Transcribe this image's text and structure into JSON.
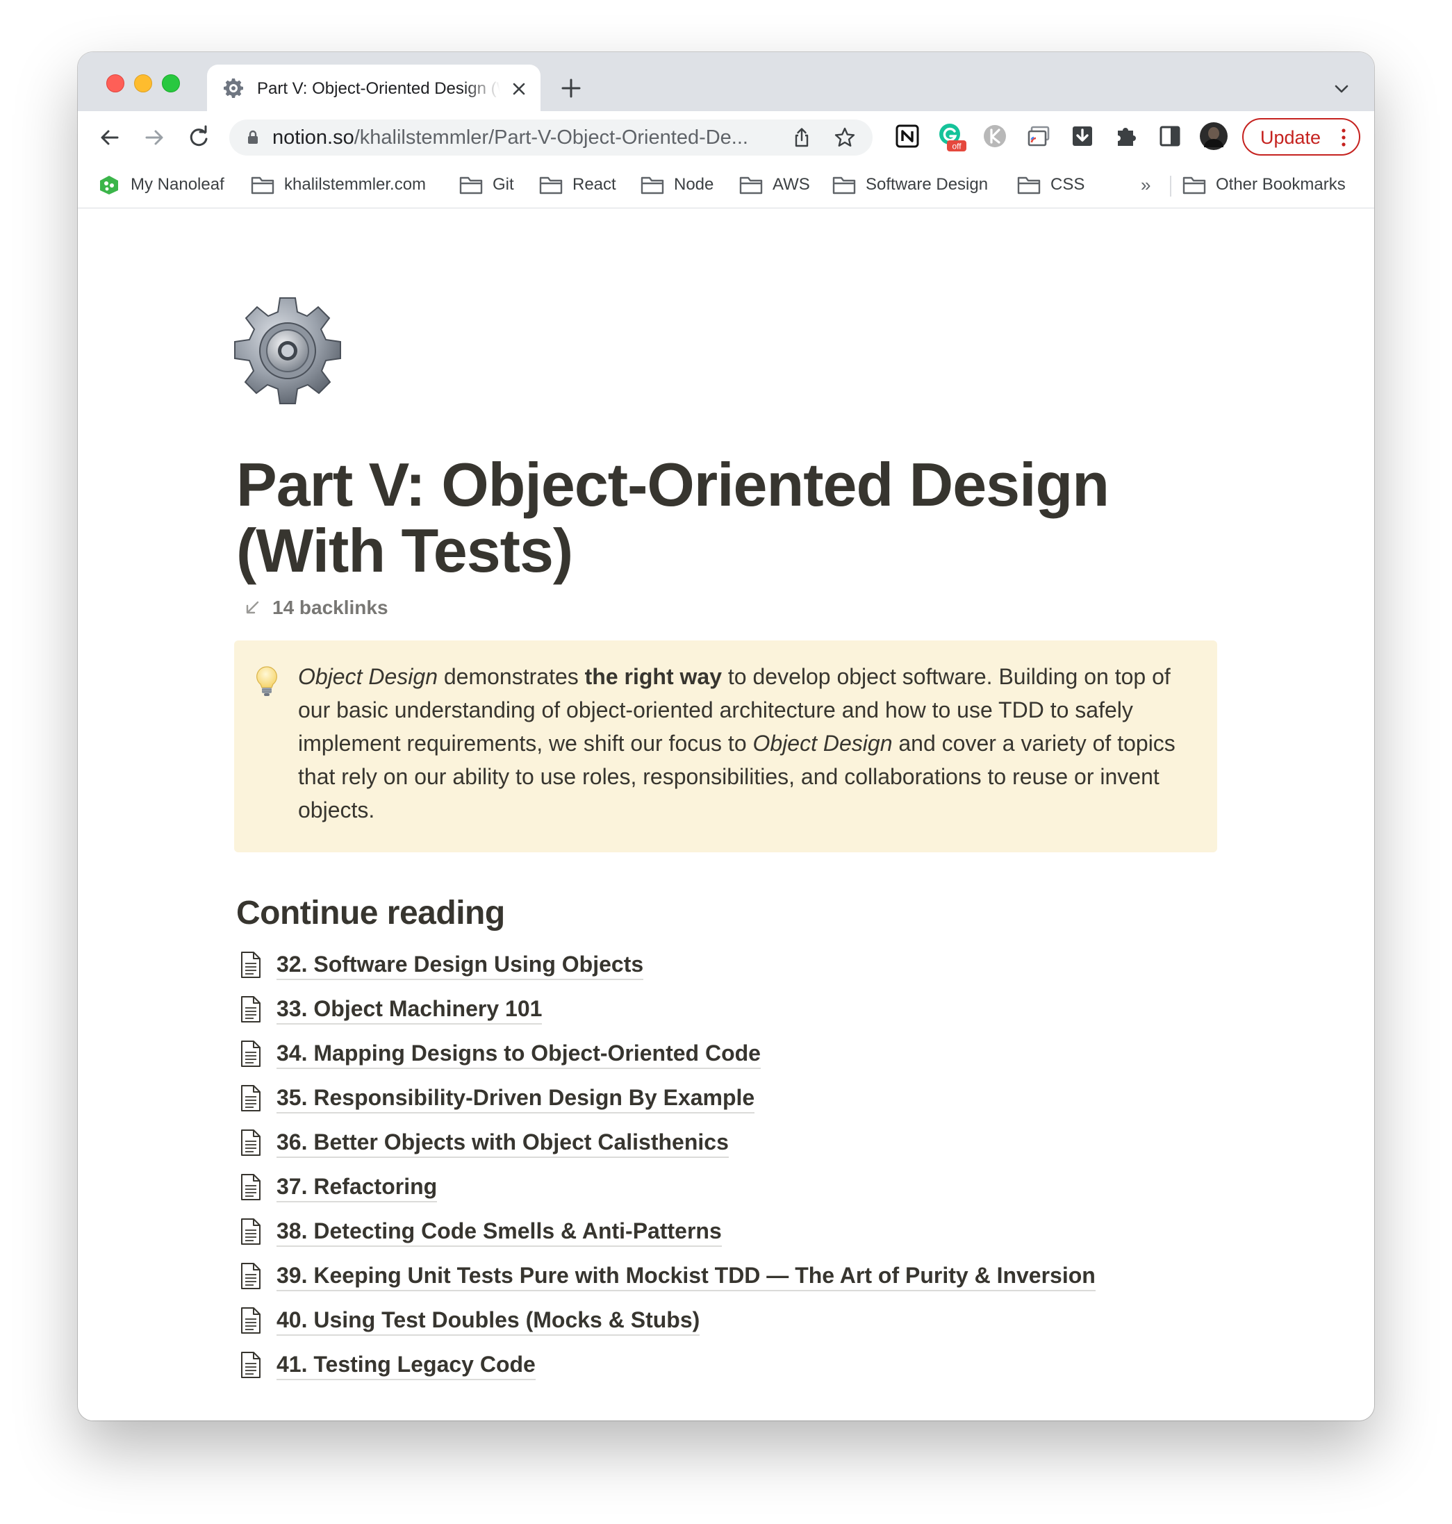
{
  "browser": {
    "tab": {
      "title": "Part V: Object-Oriented Design (With Tests)",
      "icon": "gear-icon"
    },
    "address": {
      "domain": "notion.so",
      "path": "/khalilstemmler/Part-V-Object-Oriented-De..."
    },
    "update_label": "Update",
    "extensions": [
      "notion-icon",
      "grammarly-icon",
      "k-extension-icon",
      "cast-icon",
      "download-icon",
      "puzzle-icon",
      "sidepanel-icon",
      "profile-avatar"
    ],
    "grammarly_badge": "off"
  },
  "bookmarks": {
    "items": [
      {
        "label": "My Nanoleaf",
        "icon": "nanoleaf-icon"
      },
      {
        "label": "khalilstemmler.com",
        "icon": "folder-icon"
      },
      {
        "label": "Git",
        "icon": "folder-icon"
      },
      {
        "label": "React",
        "icon": "folder-icon"
      },
      {
        "label": "Node",
        "icon": "folder-icon"
      },
      {
        "label": "AWS",
        "icon": "folder-icon"
      },
      {
        "label": "Software Design",
        "icon": "folder-icon"
      },
      {
        "label": "CSS",
        "icon": "folder-icon"
      }
    ],
    "more": "»",
    "other": "Other Bookmarks"
  },
  "page": {
    "title": "Part V: Object-Oriented Design (With Tests)",
    "backlinks": "14 backlinks",
    "callout": {
      "icon": "lightbulb-icon",
      "p1_em": "Object Design",
      "p1_text": " demonstrates ",
      "p1_strong": "the right way",
      "p1_rest": " to develop object software. Building on top of our basic understanding of object-oriented architecture and how to use TDD to safely implement requirements, we shift our focus to ",
      "p2_em": "Object Design",
      "p2_rest": " and cover a variety of topics that rely on our ability to use roles, responsibilities, and collaborations to reuse or invent objects."
    },
    "section_heading": "Continue reading",
    "links": [
      "32. Software Design Using Objects",
      "33. Object Machinery 101",
      "34. Mapping Designs to Object-Oriented Code",
      "35. Responsibility-Driven Design By Example",
      "36. Better Objects with Object Calisthenics",
      "37. Refactoring",
      "38. Detecting Code Smells & Anti-Patterns",
      "39. Keeping Unit Tests Pure with Mockist TDD — The Art of Purity & Inversion",
      "40. Using Test Doubles (Mocks & Stubs)",
      "41. Testing Legacy Code"
    ]
  },
  "colors": {
    "text": "#37352f",
    "callout_bg": "#fbf3db",
    "update_red": "#c5221f",
    "tabstrip_bg": "#dee1e6"
  }
}
